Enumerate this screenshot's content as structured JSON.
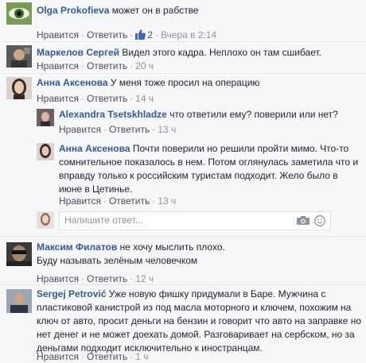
{
  "actions": {
    "like": "Нравится",
    "reply": "Ответить",
    "sep": "·"
  },
  "comments": [
    {
      "name": "Olga Prokofieva",
      "text": "может он в рабстве",
      "likes": "2",
      "time": "Вчера в 2:14"
    },
    {
      "name": "Маркелов Сергей",
      "text": "Видел этого кадра. Неплохо он там сшибает.",
      "time": "20 ч"
    },
    {
      "name": "Анна Аксенова",
      "text": "У меня тоже просил на операцию",
      "time": "14 ч"
    },
    {
      "name": "Alexandra Tsetskhladze",
      "text": "что ответили ему? поверили или нет?",
      "time": "13 ч"
    },
    {
      "name": "Анна Аксенова",
      "text_lines": [
        "Почти поверили но решили пройти мимо. Что-то",
        "сомнительное показалось в нем. Потом оглянулась заметила что и",
        "вправду только к российским туристам подходит. Жело было в",
        "июне в Цетинье."
      ],
      "time": "13 ч"
    },
    {
      "name": "Максим Филатов",
      "text_lines": [
        "не хочу мыслить плохо.",
        "Буду называть зелёным человечком"
      ],
      "time": "12 ч"
    },
    {
      "name": "Sergej Petrović",
      "text_lines": [
        "Уже новую фишку придумали в Баре. Мужчина с",
        "пластиковой канистрой из под масла моторного и ключем, похожим на",
        "ключ от авто, просит деньги на бензин и говорит что авто на заправке но",
        "нет денег и не может доехать домой. Разговаривает на сербском, но за",
        "деньгами подходит исключительно к иностранцам."
      ],
      "time": "1 ч"
    }
  ],
  "reply_box": {
    "placeholder": "Напишите ответ..."
  },
  "colors": {
    "name": "#365899",
    "muted": "#90949c",
    "accent": "#4267b2"
  }
}
